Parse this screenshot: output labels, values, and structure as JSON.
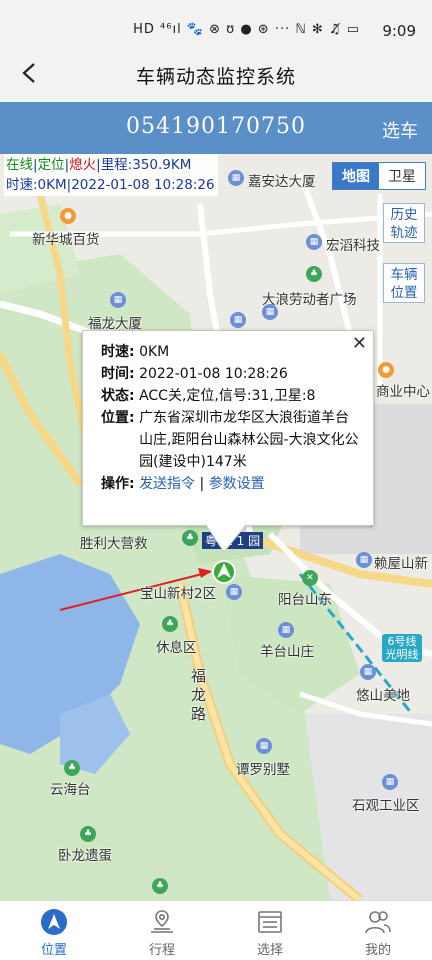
{
  "status_bar": {
    "icons": "HD ⁴⁶ıl 🐾 ⊗ ʊ ● ⊛ ···  ℕ ✻ ♫̸ ▭",
    "time": "9:09"
  },
  "header": {
    "title": "车辆动态监控系统"
  },
  "vehicle_bar": {
    "plate": "054190170750",
    "select_label": "选车"
  },
  "status_overlay": {
    "online": "在线",
    "sep1": "|",
    "located": "定位",
    "sep2": "|",
    "engine": "熄火",
    "sep3": "|",
    "mileage": "里程:350.9KM",
    "speed": "时速:0KM",
    "sep4": "|",
    "datetime": "2022-01-08 10:28:26"
  },
  "map_type": {
    "map": "地图",
    "satellite": "卫星"
  },
  "side_buttons": {
    "history": [
      "历史",
      "轨迹"
    ],
    "vehicle_pos": [
      "车辆",
      "位置"
    ]
  },
  "map_labels": {
    "jiaanda": "嘉安达大厦",
    "xinhuacheng": "新华城百货",
    "hongdao": "宏滔科技",
    "dalang_plaza": "大浪劳动者广场",
    "fulong": "福龙大厦",
    "shangye": "商业中心",
    "shengli": "胜利大营救",
    "baoshan": "宝山新村2区",
    "yangtai_east": "阳台山东",
    "xiuxi": "休息区",
    "yangtai_zhuang": "羊台山庄",
    "youshan": "悠山美地",
    "fulong_road": "福龙路",
    "tanluo": "谭罗别墅",
    "yunhai": "云海台",
    "shiguan": "石观工业区",
    "wolong": "卧龙遗蛋",
    "laiwu": "赖屋山新",
    "metro": "6号线 光明线",
    "plate_marker": "粤B1 1 园"
  },
  "popup": {
    "speed_key": "时速",
    "speed_val": "0KM",
    "time_key": "时间",
    "time_val": "2022-01-08 10:28:26",
    "state_key": "状态",
    "state_val": "ACC关,定位,信号:31,卫星:8",
    "pos_key": "位置",
    "pos_val": "广东省深圳市龙华区大浪街道羊台山庄,距阳台山森林公园-大浪文化公园(建设中)147米",
    "op_key": "操作",
    "send_cmd": "发送指令",
    "op_sep": "|",
    "params": "参数设置",
    "colon": ":"
  },
  "tabs": [
    {
      "label": "位置",
      "icon": "location-arrow-icon",
      "active": true
    },
    {
      "label": "行程",
      "icon": "route-icon",
      "active": false
    },
    {
      "label": "选择",
      "icon": "list-icon",
      "active": false
    },
    {
      "label": "我的",
      "icon": "user-icon",
      "active": false
    }
  ],
  "colors": {
    "brand_blue": "#5b8fc8",
    "online_green": "#118a1a",
    "off_red": "#d4121a",
    "link_blue": "#2a62b0"
  }
}
